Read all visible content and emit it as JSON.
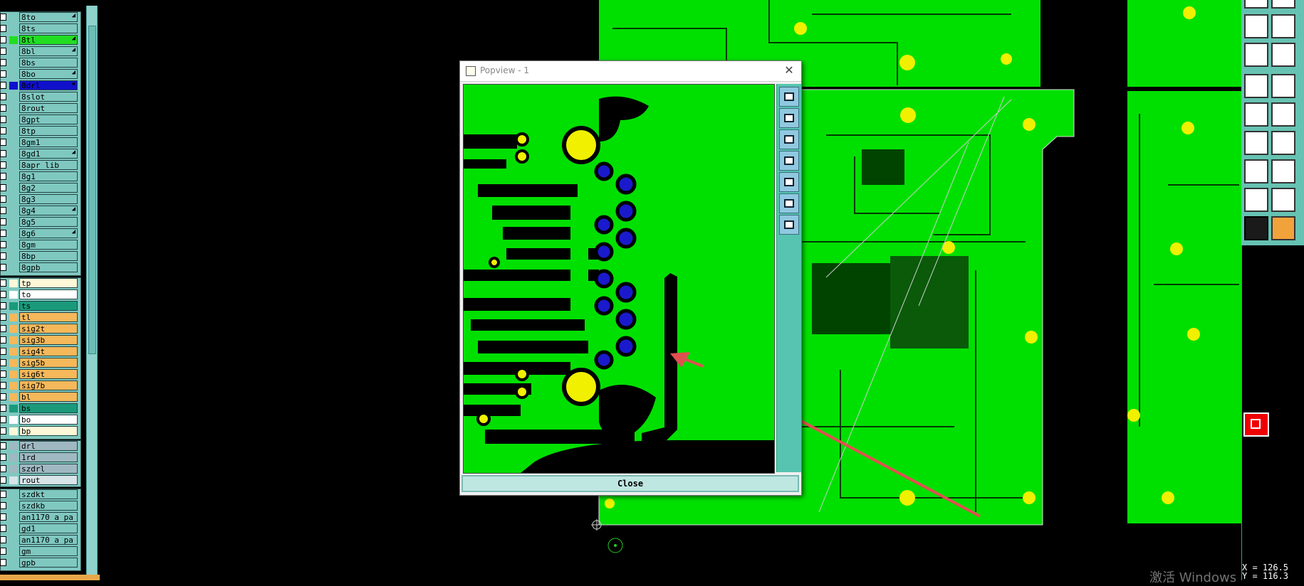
{
  "layers": {
    "group1": [
      {
        "name": "8to",
        "color": "#7fc8c0",
        "mark": "◢"
      },
      {
        "name": "8ts",
        "color": "#7fc8c0",
        "mark": ""
      },
      {
        "name": "8tl",
        "color": "#22dd22",
        "mark": "◢"
      },
      {
        "name": "8bl",
        "color": "#7fc8c0",
        "mark": "◢"
      },
      {
        "name": "8bs",
        "color": "#7fc8c0",
        "mark": ""
      },
      {
        "name": "8bo",
        "color": "#7fc8c0",
        "mark": "◢"
      },
      {
        "name": "8drl",
        "color": "#1010cc",
        "mark": "▪"
      },
      {
        "name": "8slot",
        "color": "#7fc8c0",
        "mark": ""
      },
      {
        "name": "8rout",
        "color": "#7fc8c0",
        "mark": ""
      },
      {
        "name": "8gpt",
        "color": "#7fc8c0",
        "mark": ""
      },
      {
        "name": "8tp",
        "color": "#7fc8c0",
        "mark": ""
      },
      {
        "name": "8gm1",
        "color": "#7fc8c0",
        "mark": ""
      },
      {
        "name": "8gd1",
        "color": "#7fc8c0",
        "mark": "◢"
      },
      {
        "name": "8apr_lib",
        "color": "#7fc8c0",
        "mark": ""
      },
      {
        "name": "8g1",
        "color": "#7fc8c0",
        "mark": ""
      },
      {
        "name": "8g2",
        "color": "#7fc8c0",
        "mark": ""
      },
      {
        "name": "8g3",
        "color": "#7fc8c0",
        "mark": ""
      },
      {
        "name": "8g4",
        "color": "#7fc8c0",
        "mark": "◢"
      },
      {
        "name": "8g5",
        "color": "#7fc8c0",
        "mark": ""
      },
      {
        "name": "8g6",
        "color": "#7fc8c0",
        "mark": "◢"
      },
      {
        "name": "8gm",
        "color": "#7fc8c0",
        "mark": ""
      },
      {
        "name": "8bp",
        "color": "#7fc8c0",
        "mark": ""
      },
      {
        "name": "8gpb",
        "color": "#7fc8c0",
        "mark": ""
      }
    ],
    "group2": [
      {
        "name": "tp",
        "color": "#fff8d8"
      },
      {
        "name": "to",
        "color": "#ffffff"
      },
      {
        "name": "ts",
        "color": "#1a9a7a"
      },
      {
        "name": "tl",
        "color": "#f5b85a"
      },
      {
        "name": "sig2t",
        "color": "#f5b85a"
      },
      {
        "name": "sig3b",
        "color": "#f5b85a"
      },
      {
        "name": "sig4t",
        "color": "#f5b85a"
      },
      {
        "name": "sig5b",
        "color": "#f5b85a"
      },
      {
        "name": "sig6t",
        "color": "#f5b85a"
      },
      {
        "name": "sig7b",
        "color": "#f5b85a"
      },
      {
        "name": "bl",
        "color": "#f5b85a"
      },
      {
        "name": "bs",
        "color": "#1a9a7a"
      },
      {
        "name": "bo",
        "color": "#ffffff"
      },
      {
        "name": "bp",
        "color": "#fff8d8"
      }
    ],
    "group3": [
      {
        "name": "drl",
        "color": "#9fb8c2"
      },
      {
        "name": "1rd",
        "color": "#9fb8c2"
      },
      {
        "name": "szdrl",
        "color": "#9fb8c2"
      },
      {
        "name": "rout",
        "color": "#d8e4e8"
      }
    ],
    "group4": [
      {
        "name": "szdkt",
        "color": "#7fc8c0"
      },
      {
        "name": "szdkb",
        "color": "#7fc8c0"
      },
      {
        "name": "an1170_a_pa",
        "color": "#7fc8c0"
      },
      {
        "name": "gd1",
        "color": "#7fc8c0"
      },
      {
        "name": "an1170_a_pa",
        "color": "#7fc8c0"
      },
      {
        "name": "gm",
        "color": "#7fc8c0"
      },
      {
        "name": "gpb",
        "color": "#7fc8c0"
      }
    ]
  },
  "popview": {
    "title": "Popview - 1",
    "close_label": "Close",
    "toolbar_icons": [
      "zoom-in-icon",
      "layer-up-icon",
      "layer-down-icon",
      "pan-left-icon",
      "pan-right-icon",
      "fit-icon",
      "center-icon"
    ]
  },
  "status": {
    "coord_x": "X = 126.5",
    "coord_y": "Y = 116.3"
  },
  "watermark": "激活 Windows",
  "colors": {
    "board_green": "#00e000",
    "pad_yellow": "#f0f000",
    "via_blue": "#1a1acc",
    "arrow_red": "#e05050",
    "panel_teal": "#66c2b2"
  }
}
